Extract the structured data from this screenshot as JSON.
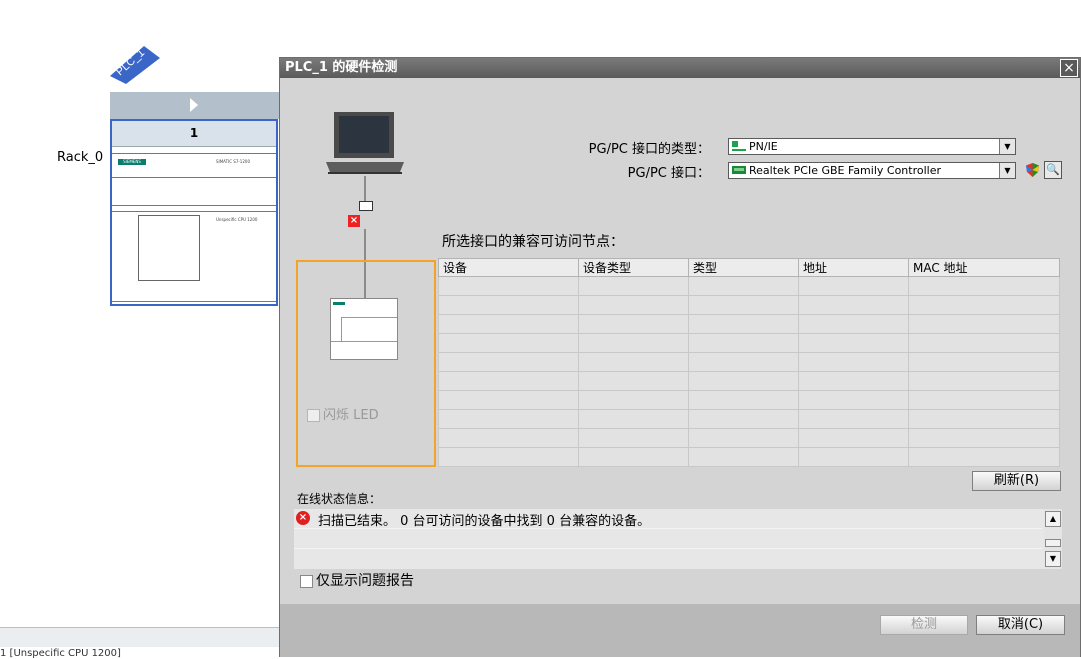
{
  "device_view": {
    "plc_tag": "PLC_1",
    "rack_label": "Rack_0",
    "slot_number": "1",
    "cpu_brand": "SIEMENS",
    "cpu_model_line1": "SIMATIC S7-1200",
    "cpu_model_line2": "Unspecific CPU 1200",
    "status_bar_text": "1 [Unspecific CPU 1200]"
  },
  "dialog": {
    "title": "PLC_1 的硬件检测",
    "close_glyph": "×",
    "pgpc_type_label": "PG/PC 接口的类型：",
    "pgpc_type_value": "PN/IE",
    "pgpc_interface_label": "PG/PC 接口：",
    "pgpc_interface_value": "Realtek PCIe GBE Family Controller",
    "flash_led_label": "闪烁 LED",
    "nodes_title": "所选接口的兼容可访问节点：",
    "table": {
      "columns": [
        "设备",
        "设备类型",
        "类型",
        "地址",
        "MAC 地址"
      ],
      "rows": []
    },
    "refresh_button": "刷新(R)",
    "status_label": "在线状态信息：",
    "status_message": "扫描已结束。 0 台可访问的设备中找到 0 台兼容的设备。",
    "only_issues_label": "仅显示问题报告",
    "detect_button": "检测",
    "cancel_button": "取消(C)"
  }
}
